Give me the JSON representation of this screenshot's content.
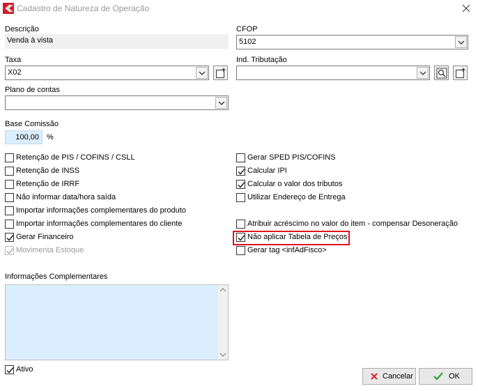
{
  "window": {
    "title": "Cadastro de Natureza de Operação"
  },
  "fields": {
    "descricao": {
      "label": "Descrição",
      "value": "Venda à vista"
    },
    "cfop": {
      "label": "CFOP",
      "value": "5102"
    },
    "taxa": {
      "label": "Taxa",
      "value": "X02"
    },
    "ind_tributacao": {
      "label": "Ind. Tributação",
      "value": ""
    },
    "plano_contas": {
      "label": "Plano de contas",
      "value": ""
    },
    "base_comissao": {
      "label": "Base Comissão",
      "value": "100,00",
      "unit": "%"
    }
  },
  "left_checks": [
    {
      "label": "Retenção de PIS / COFINS / CSLL",
      "checked": false,
      "enabled": true
    },
    {
      "label": "Retenção de INSS",
      "checked": false,
      "enabled": true
    },
    {
      "label": "Retenção de IRRF",
      "checked": false,
      "enabled": true
    },
    {
      "label": "Não informar data/hora saída",
      "checked": false,
      "enabled": true
    },
    {
      "label": "Importar informações complementares do produto",
      "checked": false,
      "enabled": true
    },
    {
      "label": "Importar informações complementares do cliente",
      "checked": false,
      "enabled": true
    },
    {
      "label": "Gerar Financeiro",
      "checked": true,
      "enabled": true
    },
    {
      "label": "Movimenta Estoque",
      "checked": true,
      "enabled": false
    }
  ],
  "right_checks": [
    {
      "label": "Gerar SPED PIS/COFINS",
      "checked": false,
      "enabled": true
    },
    {
      "label": "Calcular IPI",
      "checked": true,
      "enabled": true
    },
    {
      "label": "Calcular o valor dos tributos",
      "checked": true,
      "enabled": true
    },
    {
      "label": "Utilizar Endereço de Entrega",
      "checked": false,
      "enabled": true
    },
    {
      "label": "Atribuir acréscimo no valor do item - compensar Desoneração",
      "checked": false,
      "enabled": true
    },
    {
      "label": "Não aplicar Tabela de Preços",
      "checked": true,
      "enabled": true,
      "highlighted": true
    },
    {
      "label": "Gerar tag <infAdFisco>",
      "checked": false,
      "enabled": true
    }
  ],
  "info_complementares": {
    "label": "Informações Complementares",
    "value": ""
  },
  "ativo": {
    "label": "Ativo",
    "checked": true
  },
  "buttons": {
    "cancel": "Cancelar",
    "ok": "OK"
  },
  "colors": {
    "highlight": "#e0121b",
    "memo_bg": "#dbeeff",
    "ok_icon": "#3aa935",
    "cancel_icon": "#d9262f"
  }
}
